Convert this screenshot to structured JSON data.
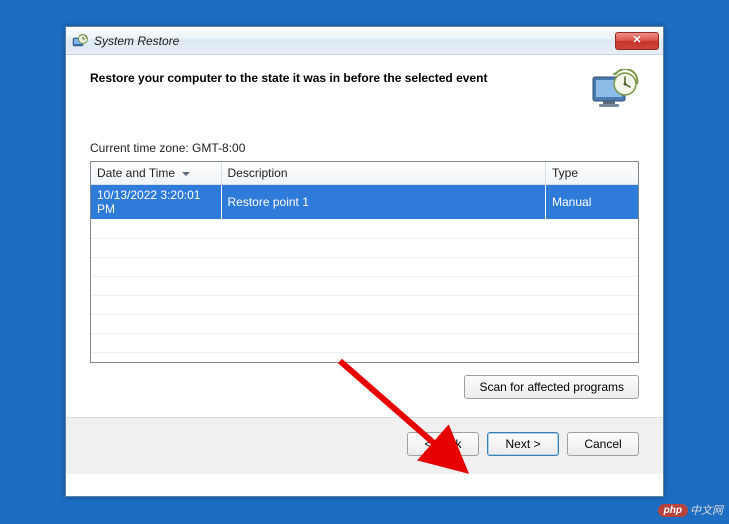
{
  "window": {
    "title": "System Restore"
  },
  "heading": "Restore your computer to the state it was in before the selected event",
  "timezone_label": "Current time zone: GMT-8:00",
  "table": {
    "columns": {
      "date": "Date and Time",
      "description": "Description",
      "type": "Type"
    },
    "rows": [
      {
        "date": "10/13/2022 3:20:01 PM",
        "description": "Restore point 1",
        "type": "Manual",
        "selected": true
      }
    ]
  },
  "buttons": {
    "scan": "Scan for affected programs",
    "back": "< Back",
    "next": "Next >",
    "cancel": "Cancel"
  },
  "watermark": {
    "badge": "php",
    "text": "中文网"
  }
}
